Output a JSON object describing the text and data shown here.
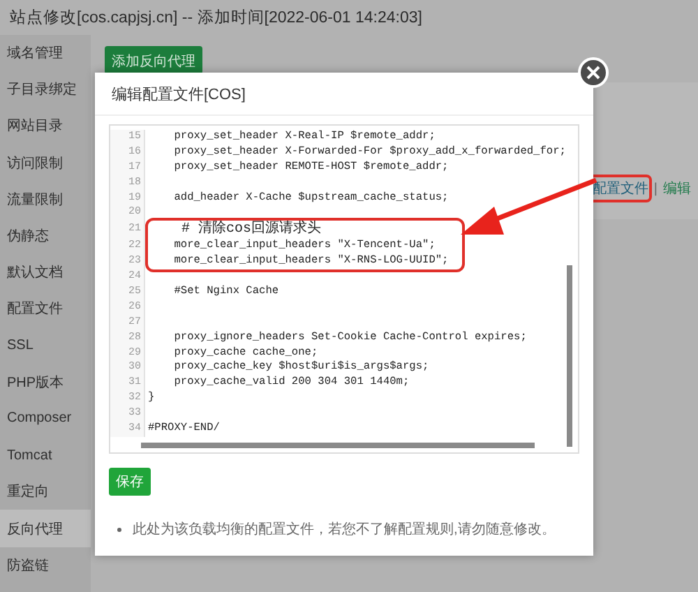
{
  "window": {
    "title": "站点修改[cos.capjsj.cn] -- 添加时间[2022-06-01 14:24:03]"
  },
  "sidebar": {
    "items": [
      {
        "label": "域名管理",
        "selected": false
      },
      {
        "label": "子目录绑定",
        "selected": false
      },
      {
        "label": "网站目录",
        "selected": false
      },
      {
        "label": "访问限制",
        "selected": false
      },
      {
        "label": "流量限制",
        "selected": false
      },
      {
        "label": "伪静态",
        "selected": false
      },
      {
        "label": "默认文档",
        "selected": false
      },
      {
        "label": "配置文件",
        "selected": false
      },
      {
        "label": "SSL",
        "selected": false
      },
      {
        "label": "PHP版本",
        "selected": false
      },
      {
        "label": "Composer",
        "selected": false
      },
      {
        "label": "Tomcat",
        "selected": false
      },
      {
        "label": "重定向",
        "selected": false
      },
      {
        "label": "反向代理",
        "selected": true
      },
      {
        "label": "防盗链",
        "selected": false
      }
    ]
  },
  "toolbar": {
    "add_button": "添加反向代理"
  },
  "proxy_row": {
    "separator": "|",
    "actions": [
      {
        "label": "配置文件",
        "highlighted": true
      },
      {
        "label": "编辑",
        "highlighted": false
      }
    ]
  },
  "dialog": {
    "title": "编辑配置文件[COS]",
    "editor": {
      "lines": [
        {
          "number": "15",
          "code": "    proxy_set_header X-Real-IP $remote_addr;",
          "highlighted": false
        },
        {
          "number": "16",
          "code": "    proxy_set_header X-Forwarded-For $proxy_add_x_forwarded_for;",
          "highlighted": false
        },
        {
          "number": "17",
          "code": "    proxy_set_header REMOTE-HOST $remote_addr;",
          "highlighted": false
        },
        {
          "number": "18"
        },
        {
          "number": "19",
          "code": "    add_header X-Cache $upstream_cache_status;",
          "highlighted": false
        },
        {
          "number": "20"
        },
        {
          "number": "21",
          "code": "    # 清除cos回源请求头",
          "highlighted": true
        },
        {
          "number": "22",
          "code": "    more_clear_input_headers \"X-Tencent-Ua\";",
          "highlighted": true
        },
        {
          "number": "23",
          "code": "    more_clear_input_headers \"X-RNS-LOG-UUID\";",
          "highlighted": true
        },
        {
          "number": "24"
        },
        {
          "number": "25",
          "code": "    #Set Nginx Cache",
          "highlighted": false
        },
        {
          "number": "26"
        },
        {
          "number": "27"
        },
        {
          "number": "28",
          "code": "    proxy_ignore_headers Set-Cookie Cache-Control expires;",
          "highlighted": false
        },
        {
          "number": "29",
          "code": "    proxy_cache cache_one;",
          "highlighted": false
        },
        {
          "number": "30",
          "code": "    proxy_cache_key $host$uri$is_args$args;",
          "highlighted": false
        },
        {
          "number": "31",
          "code": "    proxy_cache_valid 200 304 301 1440m;",
          "highlighted": false
        },
        {
          "number": "32",
          "code": "}",
          "highlighted": false
        },
        {
          "number": "33"
        },
        {
          "number": "34",
          "code": "#PROXY-END/",
          "highlighted": false
        }
      ]
    },
    "save_button": "保存",
    "note": "此处为该负载均衡的配置文件，若您不了解配置规则,请勿随意修改。"
  }
}
